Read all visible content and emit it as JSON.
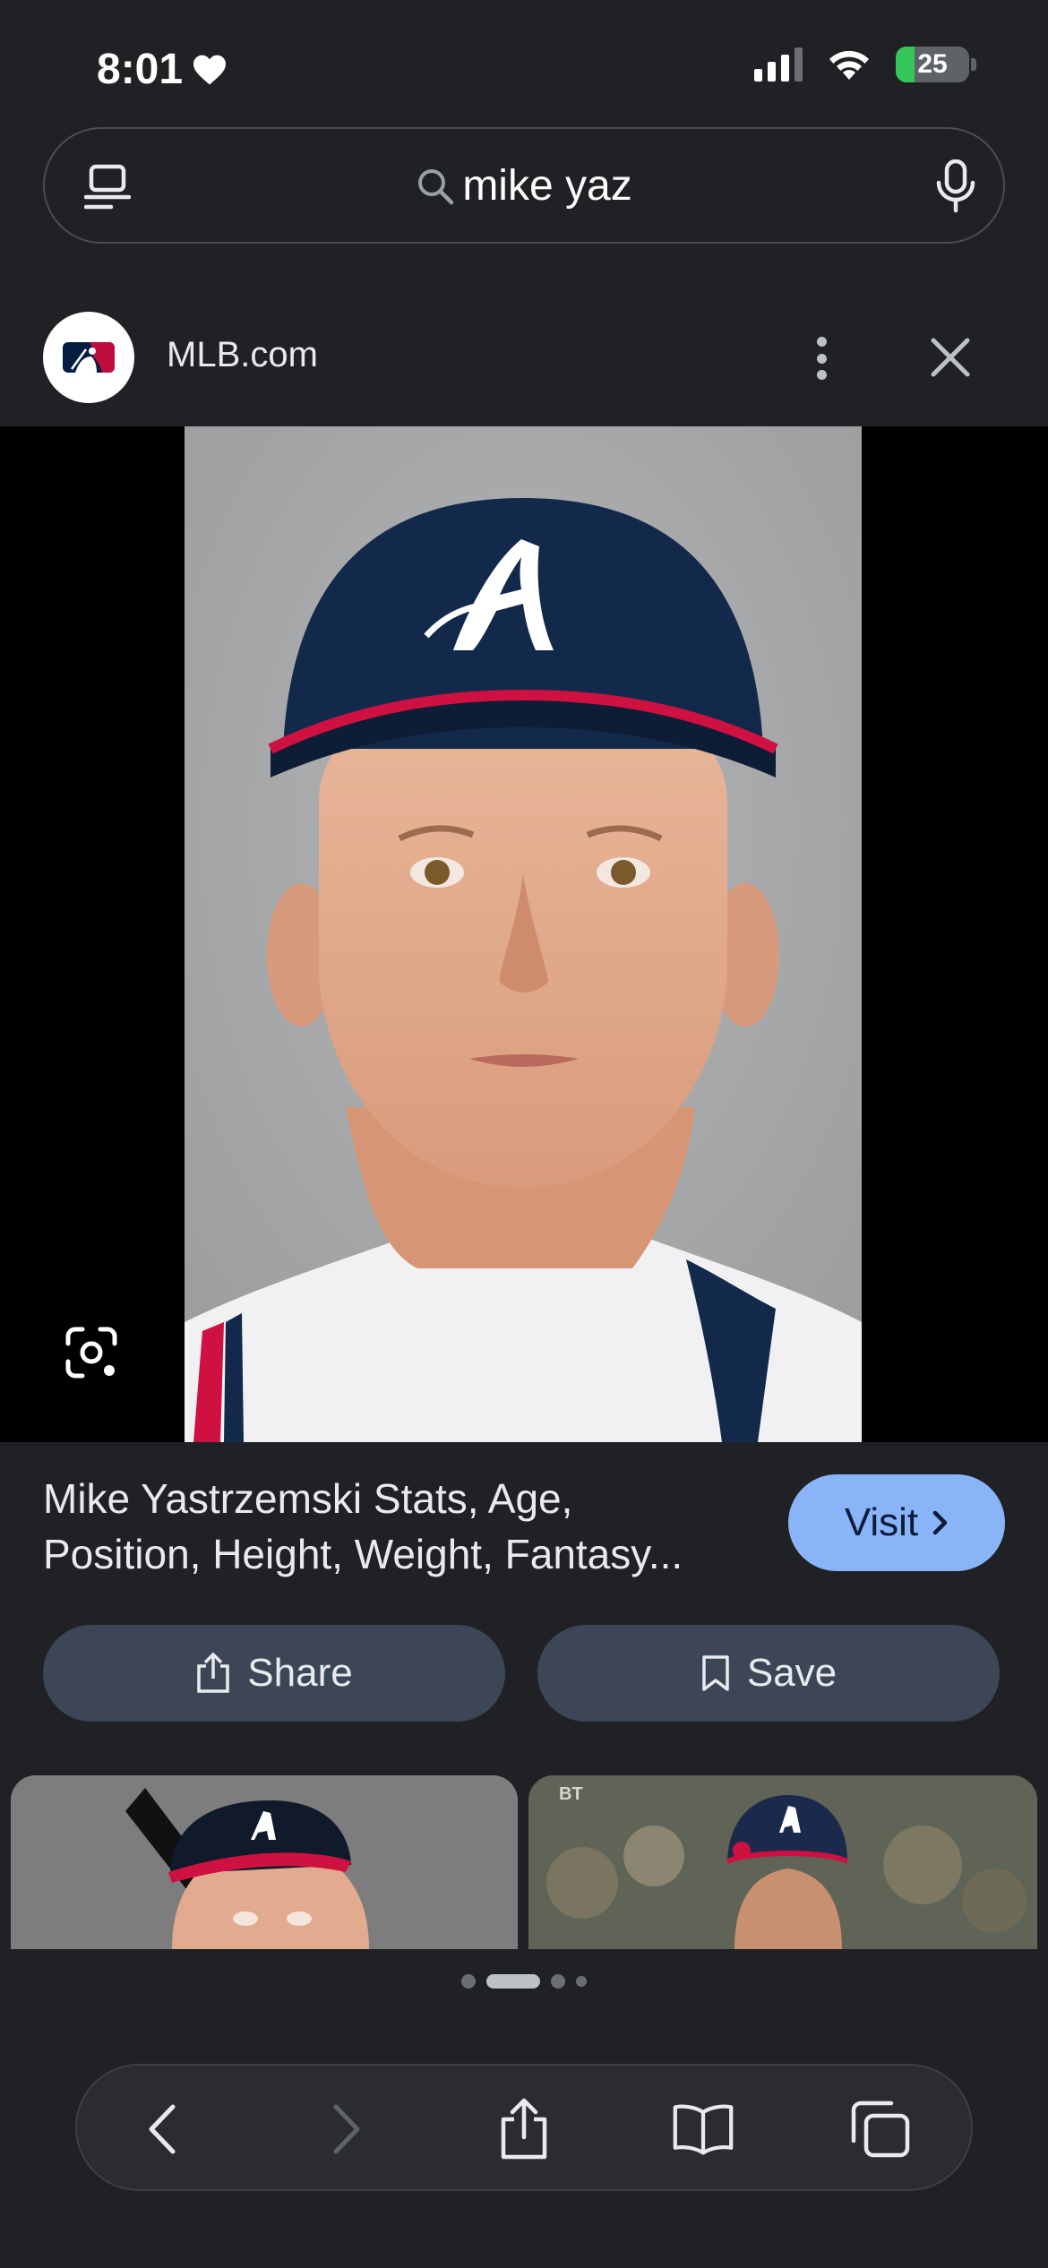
{
  "status_bar": {
    "time": "8:01",
    "battery": "25",
    "battery_level": 0.25,
    "signal_bars": 3,
    "colors": {
      "battery_fill": "#34c759"
    }
  },
  "search": {
    "query": "mike yaz",
    "icons": [
      "tabs-icon",
      "search-icon",
      "microphone-icon"
    ]
  },
  "source": {
    "name": "MLB.com",
    "icons": [
      "mlb-logo",
      "more-vert-icon",
      "close-icon"
    ]
  },
  "result": {
    "title": "Mike Yastrzemski Stats, Age, Position, Height, Weight, Fantasy...",
    "title_line1": "Mike Yastrzemski Stats, Age,",
    "title_line2": "Position, Height, Weight, Fantasy...",
    "visit_label": "Visit",
    "share_label": "Share",
    "save_label": "Save"
  },
  "thumbnails": [
    {
      "name": "related-image-1"
    },
    {
      "name": "related-image-2",
      "corner_text": "BT"
    }
  ],
  "pager": {
    "pages": 4,
    "active": 1
  },
  "toolbar": {
    "icons": [
      "back-icon",
      "forward-icon",
      "share-icon",
      "bookmarks-icon",
      "tabs-icon"
    ],
    "forward_disabled": true
  },
  "colors": {
    "background": "#202124",
    "accent": "#8ab4f8",
    "button": "#3c4656",
    "cap_navy": "#13294b",
    "cap_red": "#ce1141"
  }
}
